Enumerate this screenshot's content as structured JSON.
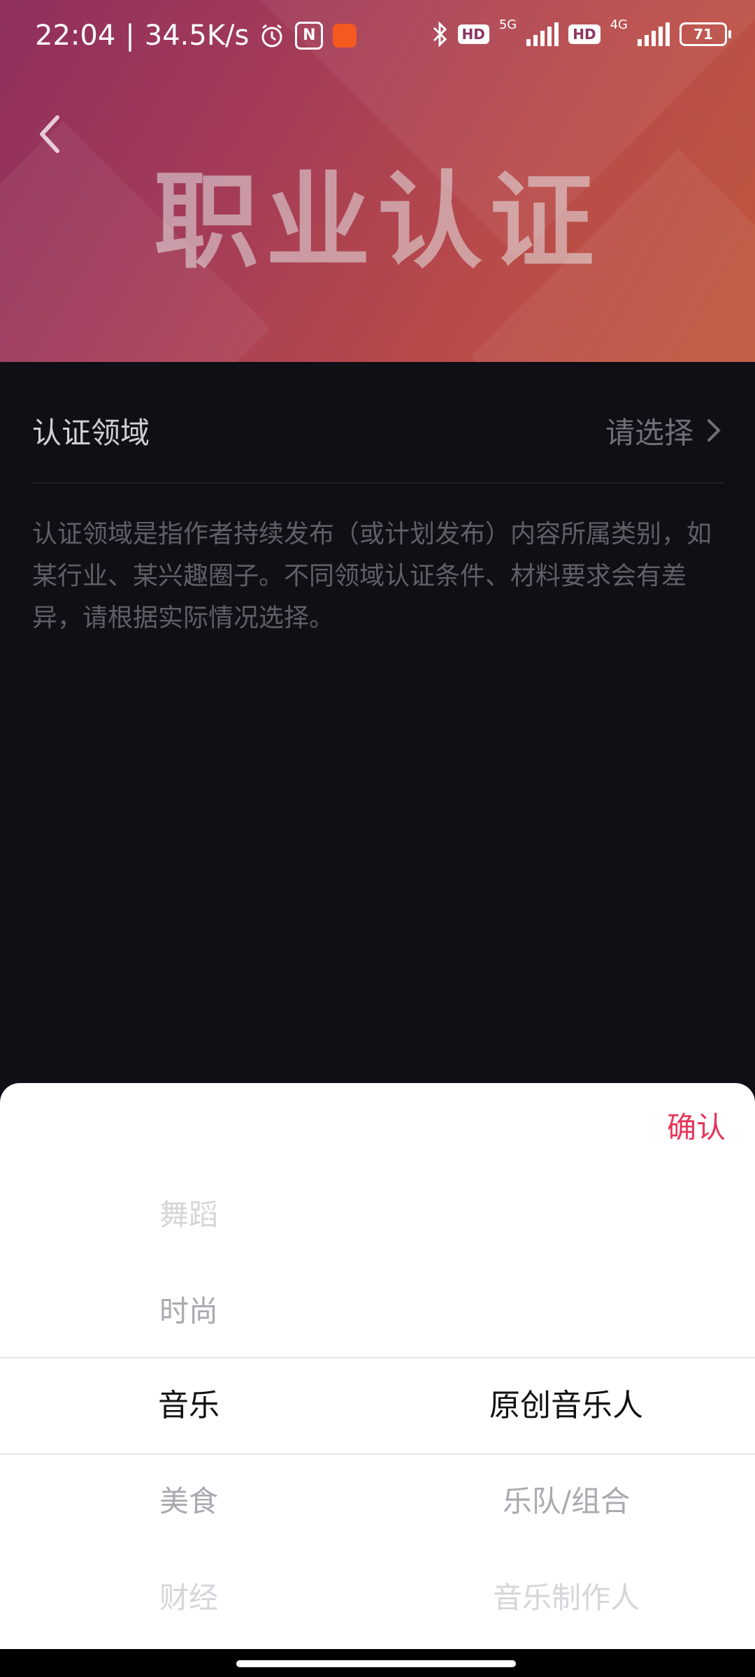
{
  "status_bar": {
    "time": "22:04",
    "separator": "|",
    "net_speed": "34.5K/s",
    "hd1": "HD",
    "net1": "5G",
    "hd2": "HD",
    "net2": "4G",
    "battery": "71"
  },
  "header": {
    "title": "职业认证"
  },
  "field": {
    "label": "认证领域",
    "value": "请选择"
  },
  "description": "认证领域是指作者持续发布（或计划发布）内容所属类别，如某行业、某兴趣圈子。不同领域认证条件、材料要求会有差异，请根据实际情况选择。",
  "picker": {
    "confirm_label": "确认",
    "left_options": [
      "舞蹈",
      "时尚",
      "音乐",
      "美食",
      "财经"
    ],
    "right_options": [
      "原创音乐人",
      "乐队/组合",
      "音乐制作人"
    ],
    "selected_left": "音乐",
    "selected_right": "原创音乐人"
  }
}
